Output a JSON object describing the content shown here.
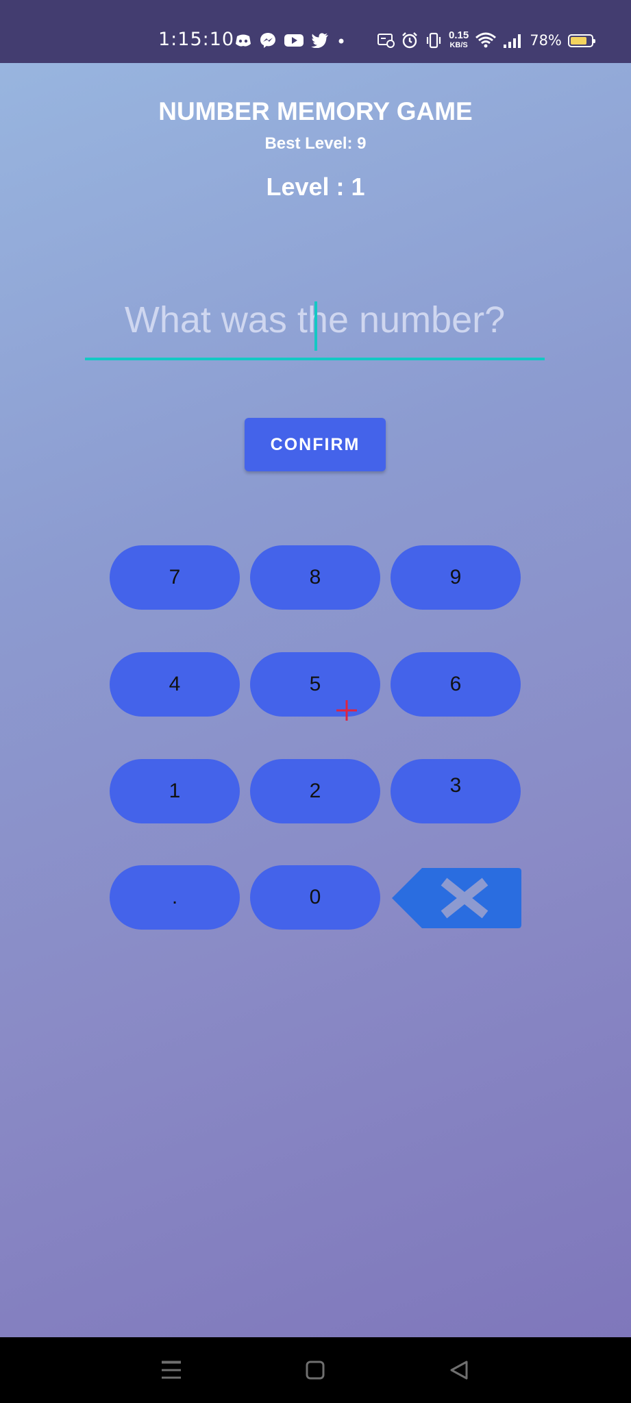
{
  "status_bar": {
    "time": "1:15:10",
    "network_speed_value": "0.15",
    "network_speed_unit": "KB/S",
    "battery_percent": "78%",
    "battery_level": 0.78,
    "colors": {
      "background": "#433d70",
      "battery": "#f4d35e"
    },
    "icons": [
      "discord-icon",
      "messenger-icon",
      "youtube-icon",
      "twitter-icon",
      "notification-dot-icon",
      "screen-cast-icon",
      "alarm-icon",
      "vibrate-icon",
      "wifi-icon",
      "signal-icon",
      "battery-icon"
    ]
  },
  "header": {
    "title": "NUMBER MEMORY GAME",
    "best_level": "Best Level: 9",
    "level": "Level : 1"
  },
  "answer": {
    "value": "",
    "placeholder": "What was the number?"
  },
  "confirm_label": "CONFIRM",
  "keypad": {
    "rows": [
      [
        "7",
        "8",
        "9"
      ],
      [
        "4",
        "5",
        "6"
      ],
      [
        "1",
        "2",
        "3"
      ],
      [
        ".",
        "0"
      ]
    ],
    "backspace_icon": "backspace-icon"
  },
  "nav_bar": {
    "icons": [
      "menu-icon",
      "home-icon",
      "back-icon"
    ]
  },
  "colors": {
    "accent": "#4463ea",
    "underline": "#13c8c4",
    "backspace": "#2a6de0",
    "gradient_top": "#98b5df",
    "gradient_bottom": "#7f77bb"
  }
}
